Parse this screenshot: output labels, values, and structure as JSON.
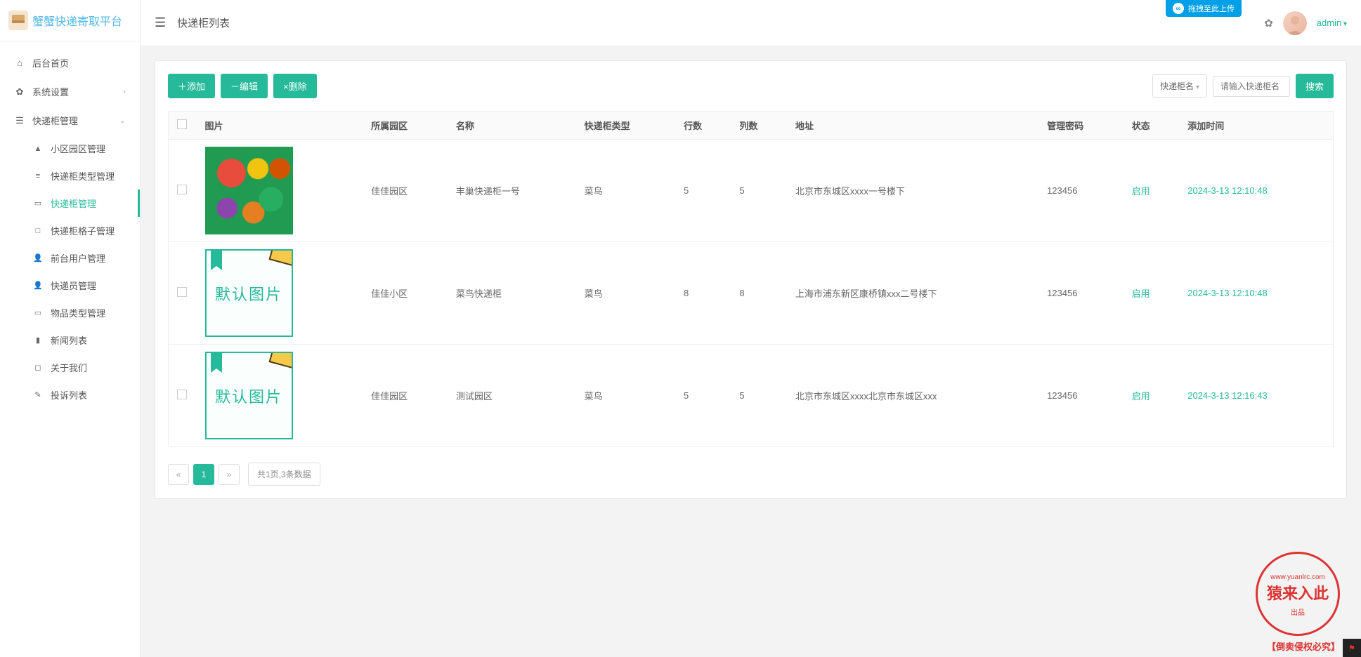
{
  "logo_text": "蟹蟹快递寄取平台",
  "page_title": "快递柜列表",
  "upload_btn": "拖拽至此上传",
  "user_name": "admin",
  "nav": {
    "home": "后台首页",
    "system": "系统设置",
    "locker_mgmt": "快递柜管理",
    "sub": {
      "community": "小区园区管理",
      "locker_type": "快递柜类型管理",
      "locker": "快递柜管理",
      "locker_cell": "快递柜格子管理",
      "front_user": "前台用户管理",
      "courier": "快递员管理",
      "item_type": "物品类型管理",
      "news": "新闻列表",
      "about": "关于我们",
      "complaint": "投诉列表"
    }
  },
  "toolbar": {
    "add": "＋添加",
    "edit": "－编辑",
    "delete": "×删除",
    "filter_select": "快递柜名",
    "search_placeholder": "请输入快递柜名",
    "search_btn": "搜索"
  },
  "table": {
    "headers": {
      "image": "图片",
      "community": "所属园区",
      "name": "名称",
      "type": "快递柜类型",
      "rows": "行数",
      "cols": "列数",
      "address": "地址",
      "password": "管理密码",
      "status": "状态",
      "created": "添加时间"
    },
    "rows": [
      {
        "img_kind": "fruits",
        "community": "佳佳园区",
        "name": "丰巢快递柜一号",
        "type": "菜鸟",
        "rows": "5",
        "cols": "5",
        "address": "北京市东城区xxxx一号楼下",
        "password": "123456",
        "status": "启用",
        "created": "2024-3-13 12:10:48"
      },
      {
        "img_kind": "default",
        "img_text": "默认图片",
        "community": "佳佳小区",
        "name": "菜鸟快递柜",
        "type": "菜鸟",
        "rows": "8",
        "cols": "8",
        "address": "上海市浦东新区康桥镇xxx二号楼下",
        "password": "123456",
        "status": "启用",
        "created": "2024-3-13 12:10:48"
      },
      {
        "img_kind": "default",
        "img_text": "默认图片",
        "community": "佳佳园区",
        "name": "测试园区",
        "type": "菜鸟",
        "rows": "5",
        "cols": "5",
        "address": "北京市东城区xxxx北京市东城区xxx",
        "password": "123456",
        "status": "启用",
        "created": "2024-3-13 12:16:43"
      }
    ]
  },
  "pagination": {
    "current": "1",
    "info": "共1页,3条数据"
  },
  "watermark": {
    "seal_sm_top": "www.yuanlrc.com",
    "seal_big": "猿来入此",
    "seal_sm_bot": "出品",
    "footer": "【倒卖侵权必究】"
  }
}
